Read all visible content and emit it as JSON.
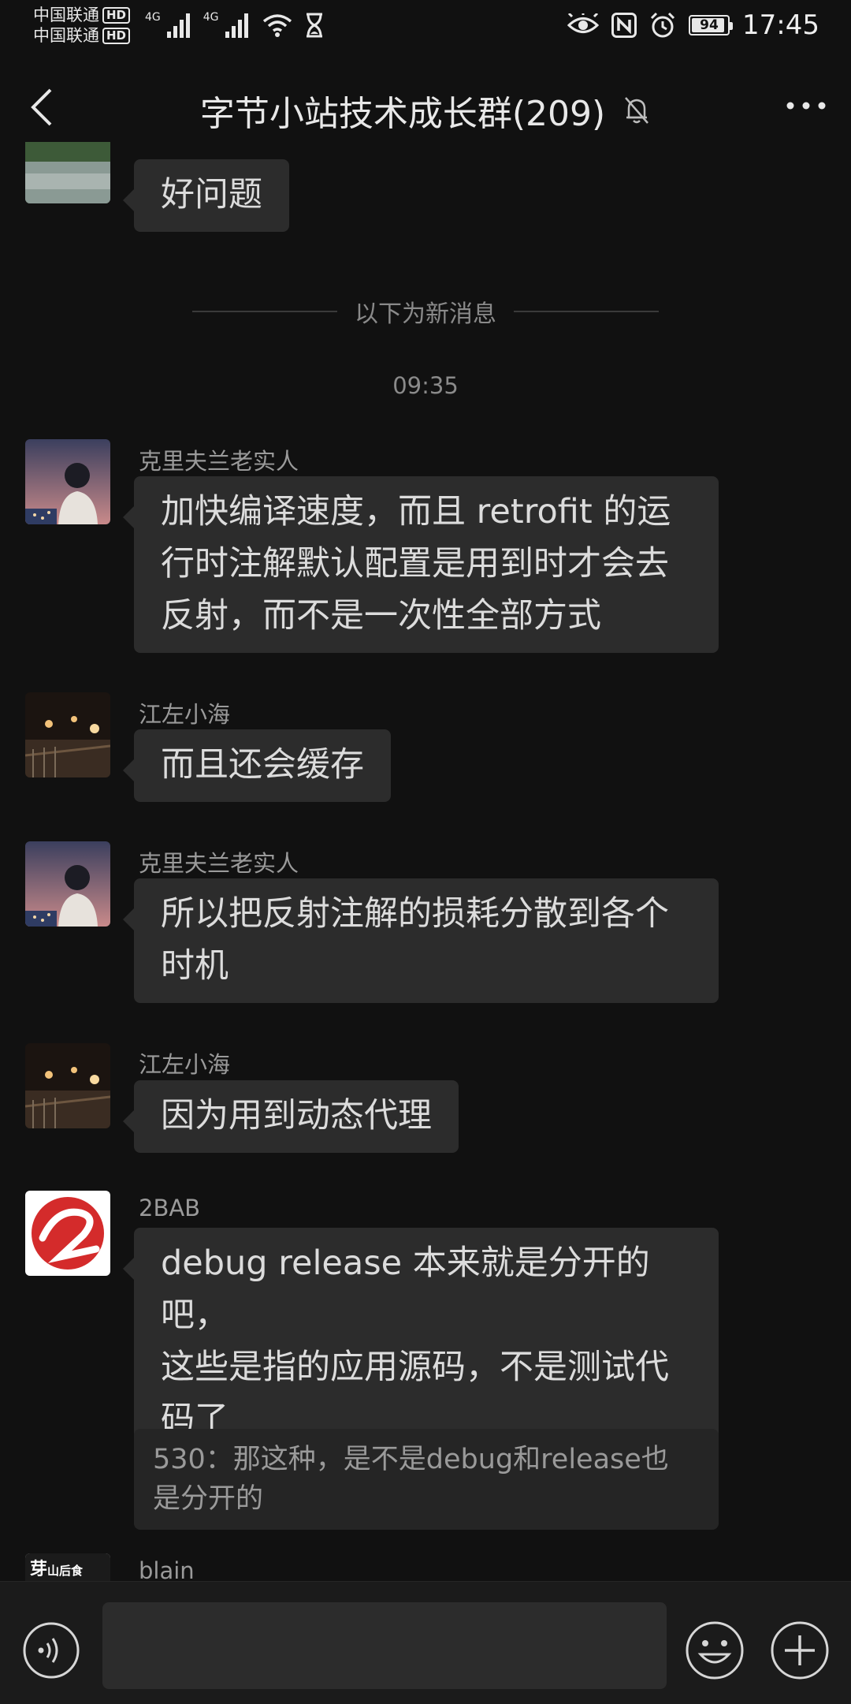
{
  "status_bar": {
    "carrier_1": "中国联通",
    "carrier_2": "中国联通",
    "hd_1": "HD",
    "hd_2": "HD",
    "net_1": "4G",
    "net_2": "4G",
    "battery": "94",
    "battery_level": 0.94,
    "time": "17:45"
  },
  "header": {
    "title": "字节小站技术成长群(209)",
    "back_icon": "chevron-left-icon",
    "mute_icon": "bell-off-icon",
    "more_icon": "more-horizontal-icon"
  },
  "messages": {
    "top_bubble": "好问题",
    "divider": "以下为新消息",
    "timestamp": "09:35",
    "m1_sender": "克里夫兰老实人",
    "m1_line1": "加快编译速度，而且 retrofit 的运",
    "m1_line2": "行时注解默认配置是用到时才会去",
    "m1_line3": "反射，而不是一次性全部方式",
    "m2_sender": "江左小海",
    "m2_text": "而且还会缓存",
    "m3_sender": "克里夫兰老实人",
    "m3_line1": "所以把反射注解的损耗分散到各个",
    "m3_line2": "时机",
    "m4_sender": "江左小海",
    "m4_text": "因为用到动态代理",
    "m5_sender": "2BAB",
    "m5_line1": "debug release 本来就是分开的吧，",
    "m5_line2": "这些是指的应用源码，不是测试代",
    "m5_line3": "码了",
    "m5_quote_line1": "530：那这种，是不是debug和release也",
    "m5_quote_line2": "是分开的",
    "m6_sender": "blain",
    "m6_avatar_text": "芽",
    "m6_avatar_text2": "山后食"
  },
  "input_bar": {
    "voice_icon": "voice-icon",
    "emoji_icon": "emoji-icon",
    "plus_icon": "plus-circle-icon"
  },
  "colors": {
    "background": "#111111",
    "bubble": "#2c2c2c",
    "quote": "#252525",
    "secondary_text": "#9a9a9a",
    "brand_red": "#d42b2b"
  }
}
